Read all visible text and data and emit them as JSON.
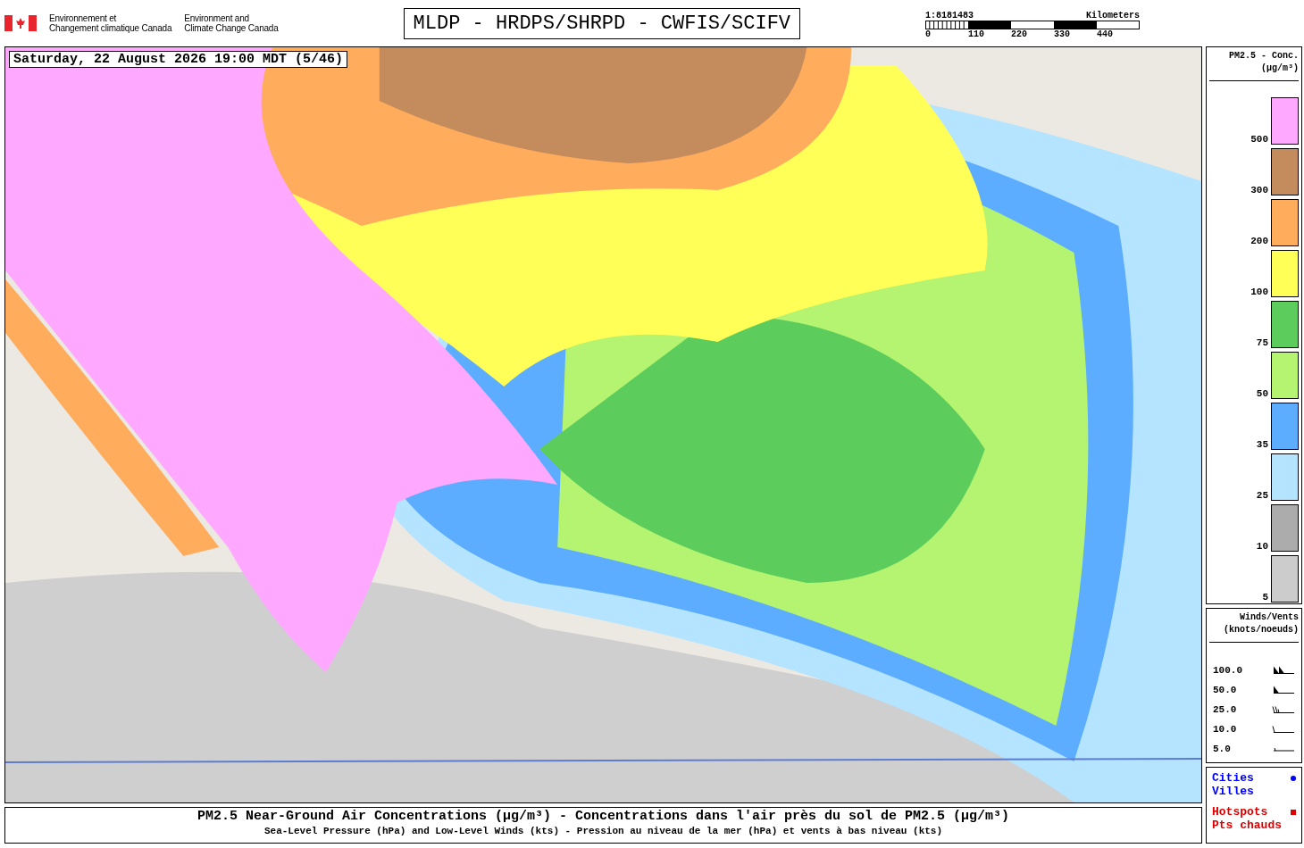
{
  "header": {
    "agency_fr": [
      "Environnement et",
      "Changement climatique Canada"
    ],
    "agency_en": [
      "Environment and",
      "Climate Change Canada"
    ],
    "title": "MLDP - HRDPS/SHRPD - CWFIS/SCIFV",
    "scale": {
      "ratio": "1:8181483",
      "unit": "Kilometers",
      "ticks": [
        "0",
        "110",
        "220",
        "330",
        "440"
      ]
    }
  },
  "map": {
    "kind": "picture",
    "timestamp": "Saturday, 22 August 2026 19:00 MDT (5/46)"
  },
  "legend": {
    "title": [
      "PM2.5 - Conc.",
      "(µg/m³)"
    ],
    "items": [
      {
        "label": "500",
        "color": "#ffa8ff"
      },
      {
        "label": "300",
        "color": "#c48c5c"
      },
      {
        "label": "200",
        "color": "#ffac5c"
      },
      {
        "label": "100",
        "color": "#ffff58"
      },
      {
        "label": "75",
        "color": "#5ccc5c"
      },
      {
        "label": "50",
        "color": "#b4f470"
      },
      {
        "label": "35",
        "color": "#5cacff"
      },
      {
        "label": "25",
        "color": "#b4e4ff"
      },
      {
        "label": "10",
        "color": "#acacac"
      },
      {
        "label": "5",
        "color": "#cccccc"
      }
    ]
  },
  "winds": {
    "title": [
      "Winds/Vents",
      "(knots/noeuds)"
    ],
    "items": [
      {
        "label": "100.0",
        "kind": "pennant2"
      },
      {
        "label": "50.0",
        "kind": "pennant"
      },
      {
        "label": "25.0",
        "kind": "barbs"
      },
      {
        "label": "10.0",
        "kind": "barb"
      },
      {
        "label": "5.0",
        "kind": "half"
      }
    ]
  },
  "markers": [
    {
      "labels": [
        "Cities",
        "Villes"
      ],
      "color": "#0000ff",
      "kind": "dot"
    },
    {
      "labels": [
        "Hotspots",
        "Pts chauds"
      ],
      "color": "#dd0000",
      "kind": "square"
    }
  ],
  "footer": {
    "line1": "PM2.5 Near-Ground Air Concentrations (µg/m³) - Concentrations dans l'air près du sol de PM2.5 (µg/m³)",
    "line2": "Sea-Level Pressure (hPa) and Low-Level Winds (kts) - Pression au niveau de la mer (hPa) et vents à bas niveau (kts)"
  }
}
